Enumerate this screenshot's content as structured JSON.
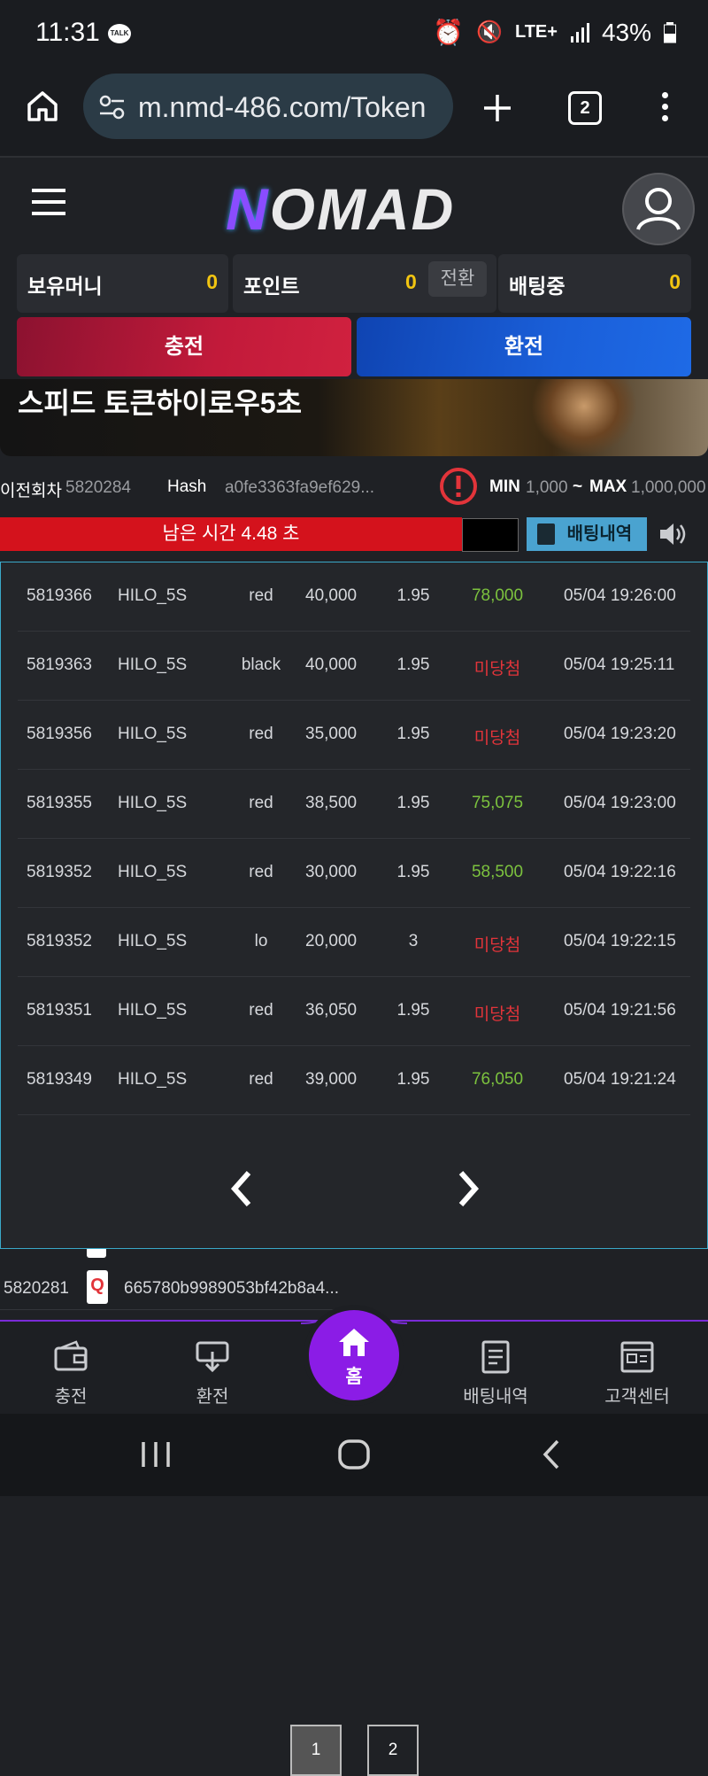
{
  "status_bar": {
    "time": "11:31",
    "talk": "TALK",
    "network": "LTE+",
    "battery": "43%"
  },
  "browser": {
    "url": "m.nmd-486.com/Token",
    "tab_count": "2"
  },
  "header": {
    "logo": "NOMAD"
  },
  "balances": {
    "money_label": "보유머니",
    "money_value": "0",
    "point_label": "포인트",
    "point_value": "0",
    "convert_label": "전환",
    "betting_label": "배팅중",
    "betting_value": "0"
  },
  "actions": {
    "charge_label": "충전",
    "exchange_label": "환전"
  },
  "banner": {
    "title": "스피드 토큰하이로우5초"
  },
  "round_info": {
    "prev_label": "이전회차",
    "prev_value": "5820284",
    "hash_label": "Hash",
    "hash_value": "a0fe3363fa9ef629...",
    "min_label": "MIN",
    "min_value": "1,000",
    "sep": "~",
    "max_label": "MAX",
    "max_value": "1,000,000"
  },
  "timer": {
    "text": "남은 시간 4.48 초",
    "history_label": "배팅내역"
  },
  "history": {
    "rows": [
      {
        "id": "5819366",
        "game": "HILO_5S",
        "pick": "red",
        "amount": "40,000",
        "odds": "1.95",
        "result": "78,000",
        "result_type": "win",
        "time": "05/04 19:26:00"
      },
      {
        "id": "5819363",
        "game": "HILO_5S",
        "pick": "black",
        "amount": "40,000",
        "odds": "1.95",
        "result": "미당첨",
        "result_type": "lose",
        "time": "05/04 19:25:11"
      },
      {
        "id": "5819356",
        "game": "HILO_5S",
        "pick": "red",
        "amount": "35,000",
        "odds": "1.95",
        "result": "미당첨",
        "result_type": "lose",
        "time": "05/04 19:23:20"
      },
      {
        "id": "5819355",
        "game": "HILO_5S",
        "pick": "red",
        "amount": "38,500",
        "odds": "1.95",
        "result": "75,075",
        "result_type": "win",
        "time": "05/04 19:23:00"
      },
      {
        "id": "5819352",
        "game": "HILO_5S",
        "pick": "red",
        "amount": "30,000",
        "odds": "1.95",
        "result": "58,500",
        "result_type": "win",
        "time": "05/04 19:22:16"
      },
      {
        "id": "5819352",
        "game": "HILO_5S",
        "pick": "lo",
        "amount": "20,000",
        "odds": "3",
        "result": "미당첨",
        "result_type": "lose",
        "time": "05/04 19:22:15"
      },
      {
        "id": "5819351",
        "game": "HILO_5S",
        "pick": "red",
        "amount": "36,050",
        "odds": "1.95",
        "result": "미당첨",
        "result_type": "lose",
        "time": "05/04 19:21:56"
      },
      {
        "id": "5819349",
        "game": "HILO_5S",
        "pick": "red",
        "amount": "39,000",
        "odds": "1.95",
        "result": "76,050",
        "result_type": "win",
        "time": "05/04 19:21:24"
      }
    ],
    "pages": [
      "1",
      "2"
    ],
    "current_page": "1"
  },
  "lower_row": {
    "round": "5820281",
    "card": "Q",
    "hash": "665780b9989053bf42b8a4..."
  },
  "bottom_nav": {
    "charge": "충전",
    "exchange": "환전",
    "home": "홈",
    "history": "배팅내역",
    "support": "고객센터"
  },
  "colors": {
    "win": "#7cc23e",
    "lose": "#e2343a",
    "accent": "#8b1ce6",
    "gold": "#f2c511"
  }
}
